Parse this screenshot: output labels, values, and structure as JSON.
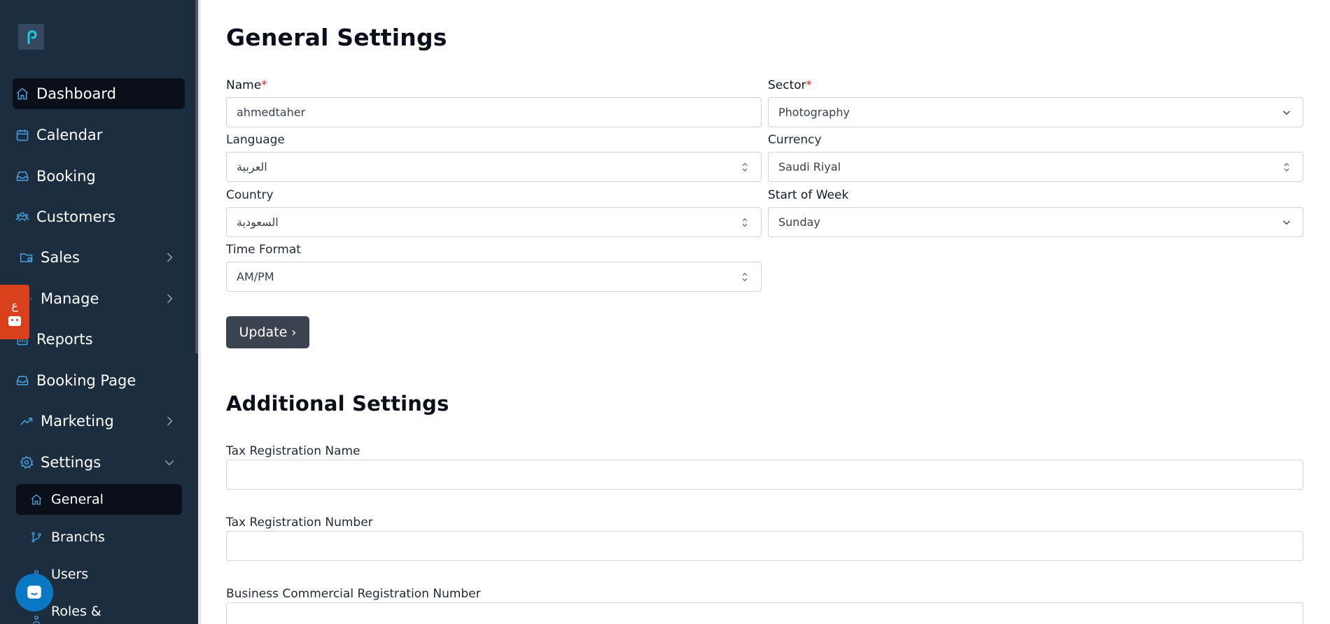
{
  "colors": {
    "sidebar_bg": "#1b2d3f",
    "active_bg": "#0b0f19",
    "icon_blue": "#4aa3e0",
    "button_bg": "#3c4350",
    "required": "#dc2626",
    "lang_tab": "#d9401c",
    "chat": "#0a78c2"
  },
  "sidebar": {
    "logo_icon": "brand-logo-icon",
    "items": [
      {
        "label": "Dashboard",
        "icon": "home-icon",
        "active": true
      },
      {
        "label": "Calendar",
        "icon": "calendar-icon"
      },
      {
        "label": "Booking",
        "icon": "inbox-icon"
      },
      {
        "label": "Customers",
        "icon": "users-icon"
      },
      {
        "label": "Sales",
        "icon": "folder-gear-icon",
        "expandable": true
      },
      {
        "label": "Manage",
        "icon": "gears-icon",
        "expandable": true
      },
      {
        "label": "Reports",
        "icon": "report-icon"
      },
      {
        "label": "Booking Page",
        "icon": "inbox-icon"
      },
      {
        "label": "Marketing",
        "icon": "trend-icon",
        "expandable": true
      },
      {
        "label": "Settings",
        "icon": "gear-icon",
        "expanded": true
      }
    ],
    "sub_items": [
      {
        "label": "General",
        "icon": "home-icon",
        "active": true
      },
      {
        "label": "Branchs",
        "icon": "branch-icon"
      },
      {
        "label": "Users",
        "icon": "users-icon"
      },
      {
        "label": "Roles &",
        "icon": "roles-icon"
      }
    ],
    "lang_tab_text": "ع"
  },
  "general": {
    "title": "General Settings",
    "name": {
      "label": "Name",
      "required": "*",
      "value": "ahmedtaher"
    },
    "sector": {
      "label": "Sector",
      "required": "*",
      "value": "Photography"
    },
    "language": {
      "label": "Language",
      "value": "العربية"
    },
    "currency": {
      "label": "Currency",
      "value": "Saudi Riyal"
    },
    "country": {
      "label": "Country",
      "value": "السعودية"
    },
    "start_of_week": {
      "label": "Start of Week",
      "value": "Sunday"
    },
    "time_format": {
      "label": "Time Format",
      "value": "AM/PM"
    },
    "update_label": "Update",
    "update_chevron": "›"
  },
  "additional": {
    "title": "Additional Settings",
    "tax_name": {
      "label": "Tax Registration Name",
      "value": ""
    },
    "tax_number": {
      "label": "Tax Registration Number",
      "value": ""
    },
    "commercial_number": {
      "label": "Business Commercial Registration Number",
      "value": ""
    }
  }
}
